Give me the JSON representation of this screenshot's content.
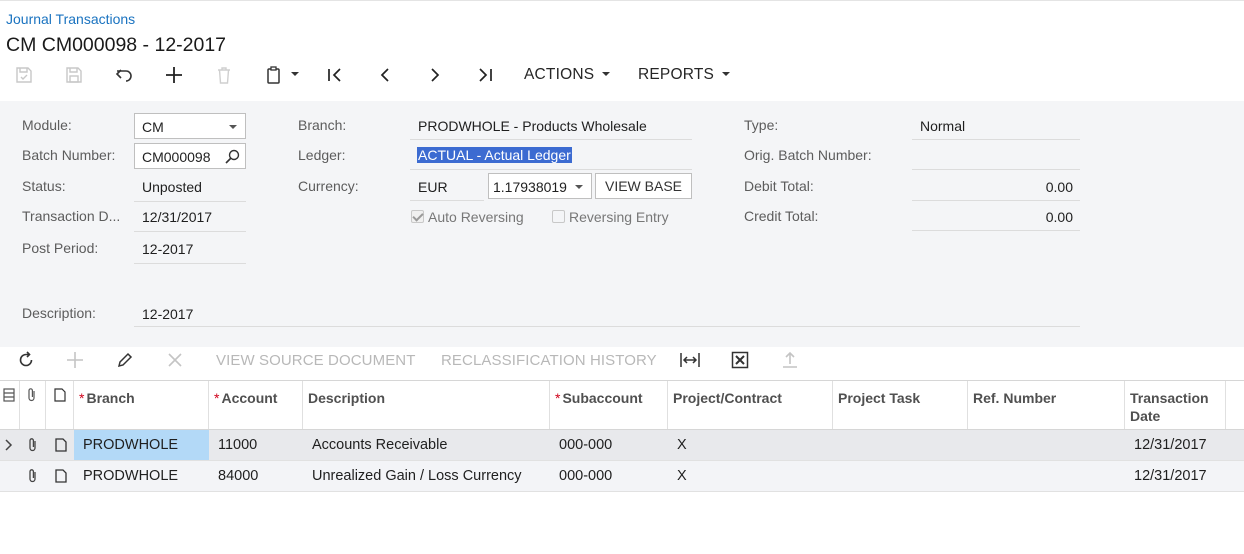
{
  "breadcrumb": "Journal Transactions",
  "title": "CM CM000098 - 12-2017",
  "toolbar": {
    "actions_label": "ACTIONS",
    "reports_label": "REPORTS",
    "icons": [
      "save-close-icon",
      "save-icon",
      "undo-icon",
      "add-icon",
      "delete-icon",
      "clipboard-icon",
      "first-record-icon",
      "previous-record-icon",
      "next-record-icon",
      "last-record-icon"
    ]
  },
  "form": {
    "module_label": "Module:",
    "module_value": "CM",
    "batch_number_label": "Batch Number:",
    "batch_number_value": "CM000098",
    "status_label": "Status:",
    "status_value": "Unposted",
    "transaction_date_label": "Transaction D...",
    "transaction_date_value": "12/31/2017",
    "post_period_label": "Post Period:",
    "post_period_value": "12-2017",
    "description_label": "Description:",
    "description_value": "12-2017",
    "branch_label": "Branch:",
    "branch_value": "PRODWHOLE - Products Wholesale",
    "ledger_label": "Ledger:",
    "ledger_value": "ACTUAL - Actual Ledger",
    "currency_label": "Currency:",
    "currency_value": "EUR",
    "currency_rate": "1.17938019",
    "view_base_label": "VIEW BASE",
    "auto_reversing_label": "Auto Reversing",
    "auto_reversing_checked": true,
    "reversing_entry_label": "Reversing Entry",
    "reversing_entry_checked": false,
    "type_label": "Type:",
    "type_value": "Normal",
    "orig_batch_label": "Orig. Batch Number:",
    "orig_batch_value": "",
    "debit_total_label": "Debit Total:",
    "debit_total_value": "0.00",
    "credit_total_label": "Credit Total:",
    "credit_total_value": "0.00"
  },
  "grid_toolbar": {
    "view_source_label": "VIEW SOURCE DOCUMENT",
    "reclass_history_label": "RECLASSIFICATION HISTORY",
    "icons": [
      "refresh-icon",
      "add-row-icon",
      "edit-icon",
      "delete-row-icon",
      "fit-columns-icon",
      "excel-export-icon",
      "upload-icon"
    ]
  },
  "grid": {
    "columns": [
      {
        "label": "Branch",
        "required": true
      },
      {
        "label": "Account",
        "required": true
      },
      {
        "label": "Description",
        "required": false
      },
      {
        "label": "Subaccount",
        "required": true
      },
      {
        "label": "Project/Contract",
        "required": false
      },
      {
        "label": "Project Task",
        "required": false
      },
      {
        "label": "Ref. Number",
        "required": false
      },
      {
        "label": "Transaction Date",
        "required": false
      }
    ],
    "rows": [
      {
        "branch": "PRODWHOLE",
        "account": "11000",
        "description": "Accounts Receivable",
        "subaccount": "000-000",
        "project": "X",
        "project_task": "",
        "ref_number": "",
        "transaction_date": "12/31/2017"
      },
      {
        "branch": "PRODWHOLE",
        "account": "84000",
        "description": "Unrealized Gain / Loss Currency",
        "subaccount": "000-000",
        "project": "X",
        "project_task": "",
        "ref_number": "",
        "transaction_date": "12/31/2017"
      }
    ]
  }
}
